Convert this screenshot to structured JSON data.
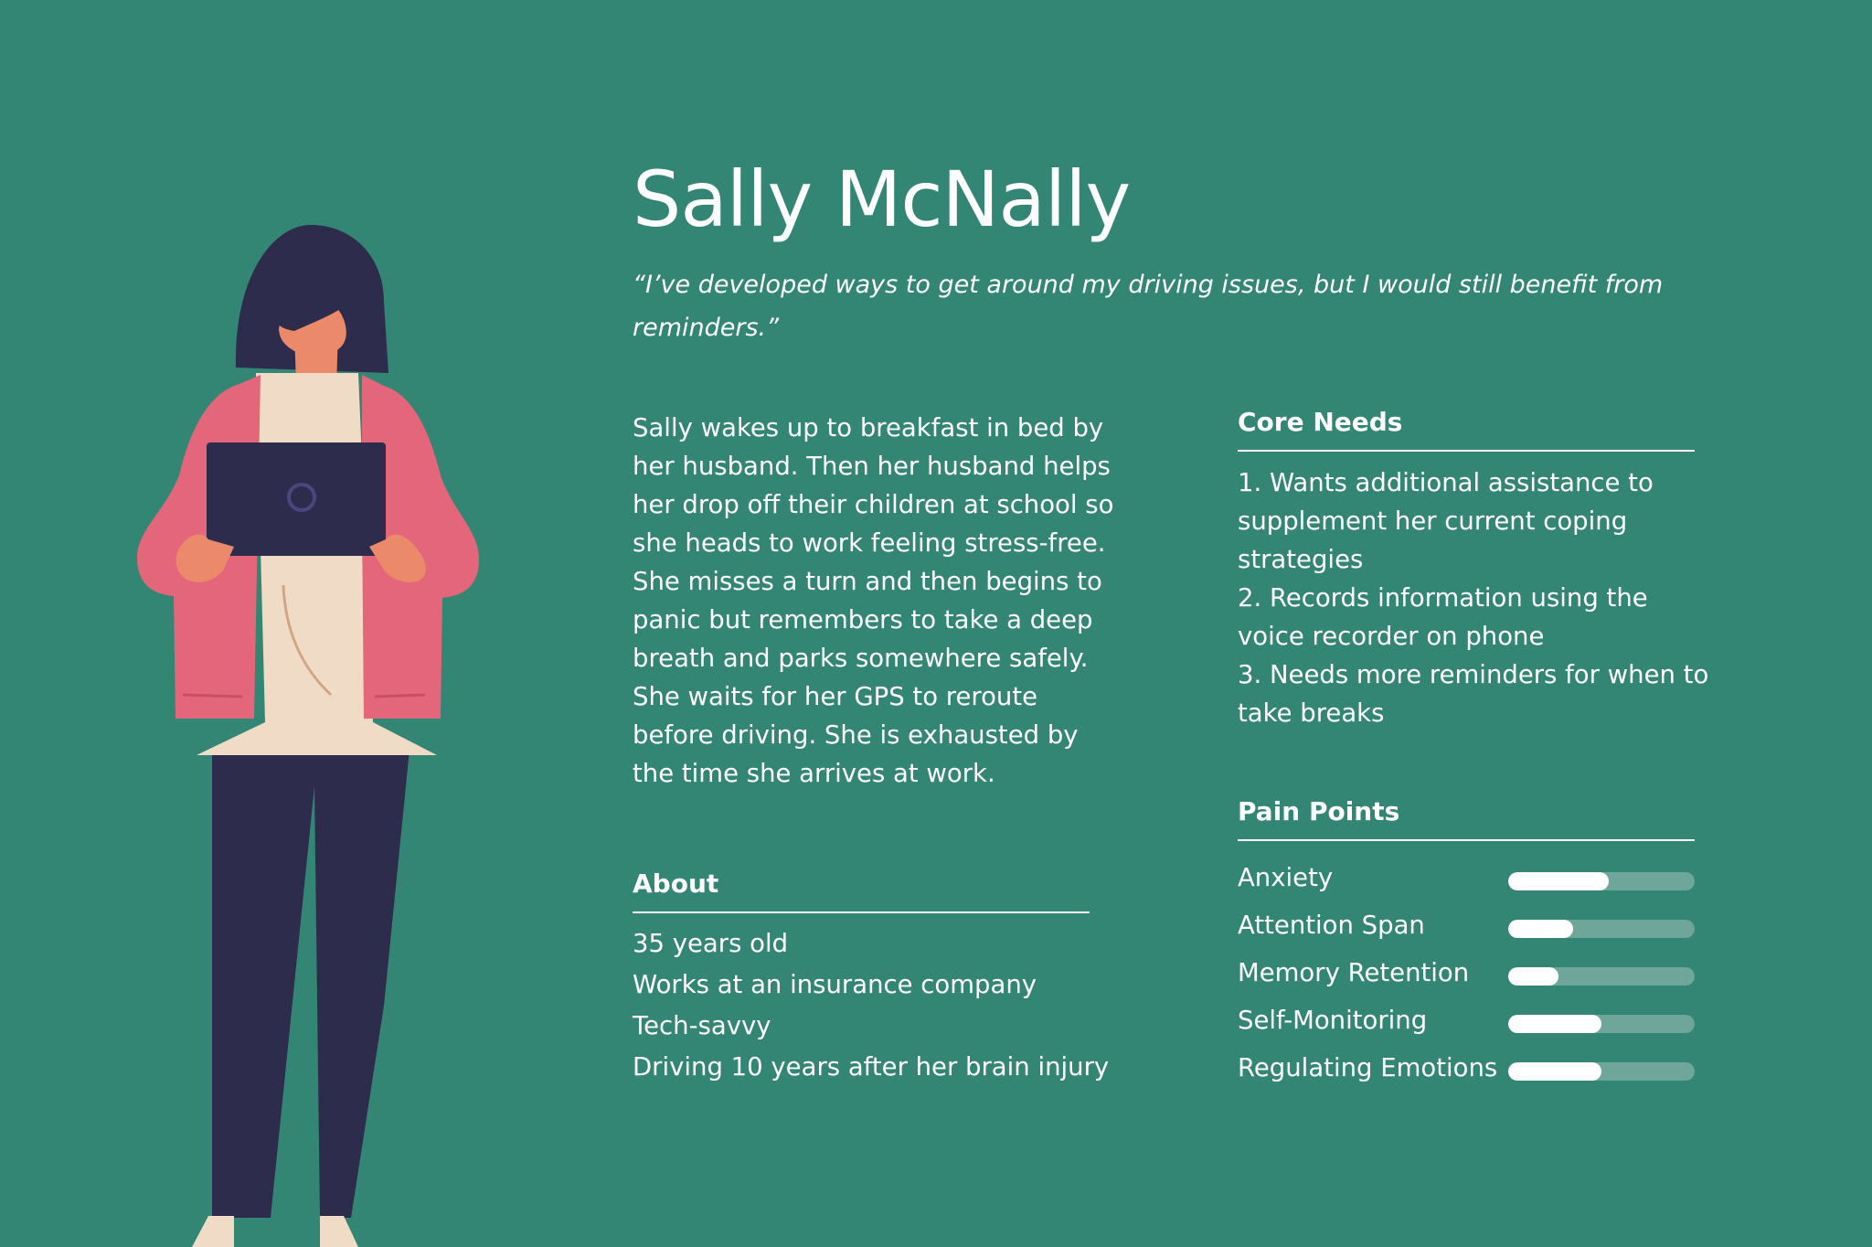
{
  "persona": {
    "name": "Sally McNally",
    "quote": "“I’ve developed ways to get around my driving issues, but I would still benefit from reminders.”",
    "story": "Sally wakes up to breakfast in bed by her husband. Then her husband helps her drop off their children at school so she heads to work feeling stress-free. She misses a turn and then begins to panic but remembers to take a deep breath and parks somewhere safely. She waits for her GPS to reroute before driving. She is exhausted by the time she arrives at work."
  },
  "about": {
    "heading": "About",
    "items": [
      "35 years old",
      "Works at an insurance company",
      "Tech-savvy",
      "Driving 10 years after her brain injury"
    ]
  },
  "core_needs": {
    "heading": "Core Needs",
    "items": [
      "1. Wants additional assistance to supplement her current coping strategies",
      "2. Records information using the voice recorder on phone",
      "3. Needs more reminders for when to take breaks"
    ]
  },
  "pain_points": {
    "heading": "Pain Points",
    "items": [
      {
        "label": "Anxiety",
        "level": 0.54
      },
      {
        "label": "Attention Span",
        "level": 0.35
      },
      {
        "label": "Memory Retention",
        "level": 0.27
      },
      {
        "label": "Self-Monitoring",
        "level": 0.5
      },
      {
        "label": "Regulating Emotions",
        "level": 0.5
      }
    ]
  },
  "colors": {
    "background": "#338574",
    "bar_track": "#6ea699",
    "bar_fill": "#ffffff",
    "jacket": "#e4667a",
    "pants": "#2e2c4c",
    "skin": "#ea8a6a",
    "shirt": "#f0dcc6"
  },
  "icons": {
    "illustration": "woman-holding-laptop-illustration"
  }
}
